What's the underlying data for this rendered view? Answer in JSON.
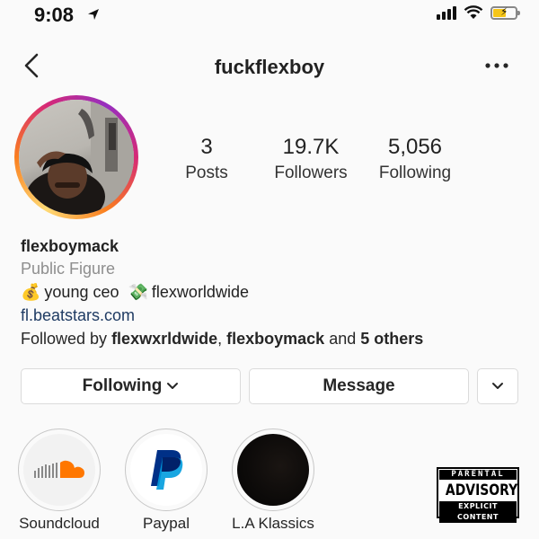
{
  "status_bar": {
    "time": "9:08",
    "icons": [
      "location-arrow-icon",
      "signal-icon",
      "wifi-icon",
      "battery-charging-icon"
    ],
    "battery_color": "#f5c518"
  },
  "header": {
    "username": "fuckflexboy",
    "back_icon": "chevron-left-icon",
    "more_icon": "more-horizontal-icon"
  },
  "profile": {
    "ring_colors": [
      "#feda75",
      "#fa7e1e",
      "#d62976",
      "#962fbf"
    ],
    "stats": [
      {
        "value": "3",
        "label": "Posts"
      },
      {
        "value": "19.7K",
        "label": "Followers"
      },
      {
        "value": "5,056",
        "label": "Following"
      }
    ]
  },
  "bio": {
    "name": "flexboymack",
    "category": "Public Figure",
    "emoji_1": "💰",
    "text_1": "young ceo",
    "emoji_2": "💸",
    "text_2": "flexworldwide",
    "link": "fl.beatstars.com",
    "link_color": "#1f3b63",
    "followed_prefix": "Followed by",
    "followed_user_1": "flexwxrldwide",
    "followed_sep": ",",
    "followed_user_2": "flexboymack",
    "followed_and": "and",
    "followed_others": "5 others"
  },
  "actions": {
    "following_label": "Following",
    "message_label": "Message",
    "expand_icon": "chevron-down-icon"
  },
  "highlights": [
    {
      "label": "Soundcloud",
      "icon": "soundcloud-icon",
      "color": "#ff7700"
    },
    {
      "label": "Paypal",
      "icon": "paypal-icon",
      "color": "#003087"
    },
    {
      "label": "L.A Klassics",
      "icon": "dark-photo"
    }
  ],
  "badge": {
    "top": "PARENTAL",
    "middle": "ADVISORY",
    "bottom": "EXPLICIT CONTENT"
  }
}
